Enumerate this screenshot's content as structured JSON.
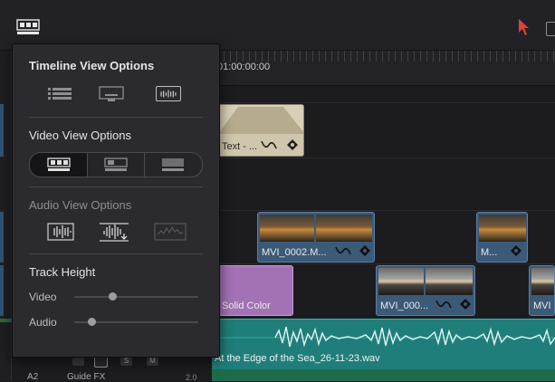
{
  "timeline": {
    "timecode": "01:00:00:00",
    "clips": {
      "text": "Text - ...",
      "mvi_0002": "MVI_0002.M...",
      "m": "M...",
      "mvi_000": "MVI_000...",
      "mvi_r": "MVI",
      "solid": "Solid Color",
      "audio": "At the Edge of the Sea_26-11-23.wav"
    },
    "track_header": {
      "solo": "S",
      "mute": "M",
      "number": "A2",
      "name": "Guide FX",
      "extra": "2.0"
    }
  },
  "panel": {
    "timeline_view_title": "Timeline View Options",
    "video_view_title": "Video View Options",
    "audio_view_title": "Audio View Options",
    "track_height_title": "Track Height",
    "video_label": "Video",
    "audio_label": "Audio",
    "video_height": 0.3,
    "audio_height": 0.12
  },
  "colors": {
    "audio_clip": "#1f7e7a",
    "video_clip": "#3b5a78",
    "solid_clip": "#a372b4",
    "text_clip": "#cfc6ad",
    "pointer": "#e0413a"
  }
}
